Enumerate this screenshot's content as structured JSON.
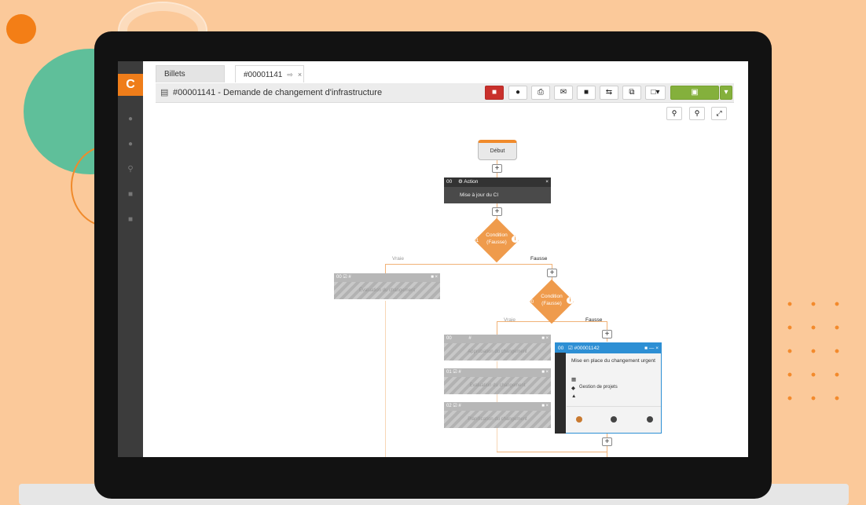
{
  "tabs": [
    {
      "label": "Billets"
    },
    {
      "label": "#00001141"
    }
  ],
  "ticket": {
    "title": "#00001141 - Demande de changement d'infrastructure"
  },
  "toolbar": {
    "icons": [
      "delete-icon",
      "comment-icon",
      "print-icon",
      "mail-icon",
      "note-icon",
      "transfer-icon",
      "copy-icon",
      "document-icon",
      "save-icon",
      "dropdown-icon"
    ]
  },
  "zoom": {
    "icons": [
      "zoom-out-icon",
      "zoom-in-icon",
      "fullscreen-icon"
    ]
  },
  "workflow": {
    "start": "Début",
    "action": {
      "num": "00",
      "title": "Action",
      "body": "Mise à jour du CI"
    },
    "cond1": {
      "num": "01",
      "label1": "Condition",
      "label2": "(Fausse)",
      "true": "Vraie",
      "false": "Fausse"
    },
    "cond2": {
      "num": "00",
      "label1": "Condition",
      "label2": "(Fausse)",
      "true": "Vraie",
      "false": "Fausse"
    },
    "left_task": {
      "num": "00",
      "hash": "#",
      "body": "Évaluation du changement"
    },
    "gray_tasks": [
      {
        "num": "00",
        "hash": "#",
        "body": "Approbation du changement"
      },
      {
        "num": "01",
        "hash": "#",
        "body": "Évaluation du changement"
      },
      {
        "num": "02",
        "hash": "#",
        "body": "Planification du changement"
      }
    ],
    "ticket_card": {
      "num": "00",
      "id": "#00001142",
      "text": "Mise en place du changement urgent",
      "category": "Gestion de projets"
    }
  },
  "colors": {
    "accent": "#ef7d1a",
    "blue": "#2d8fd4",
    "red": "#c9302c",
    "green": "#84b03c"
  }
}
